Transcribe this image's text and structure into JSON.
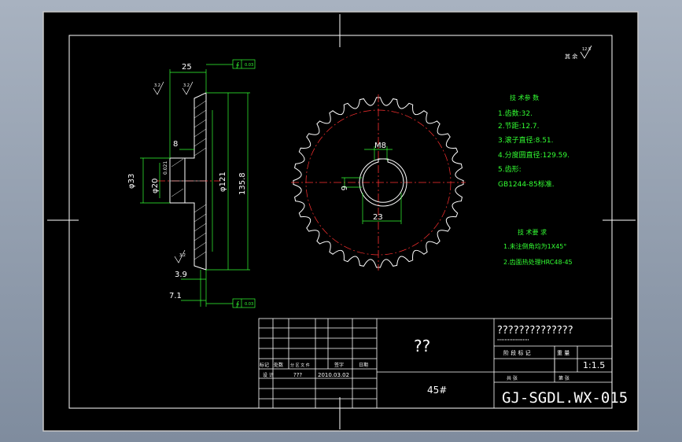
{
  "drawing": {
    "roughness_note": "其 余",
    "roughness_value": "12.5",
    "side_view": {
      "dim_width": "25",
      "dim_hub": "8",
      "dim_bore": "φ20",
      "dim_bore_tol": "0.021",
      "dim_hub_dia": "φ33",
      "dim_inner": "φ121",
      "dim_outer": "135.8",
      "dim_tooth": "3.9",
      "dim_offset": "7.1",
      "tol_top": "0.03",
      "tol_bottom": "0.03",
      "rough_1": "3.2",
      "rough_2": "3.2",
      "rough_3": "3.2"
    },
    "front_view": {
      "keyway_width": "M8",
      "keyway_depth": "6",
      "bore_span": "23"
    },
    "params": {
      "title": "技 术参 数",
      "lines": [
        "1.齿数:32.",
        "2.节距:12.7.",
        "3.滚子直径:8.51.",
        "4.分度圆直径:129.59.",
        "5.齿形:",
        "GB1244-85标准."
      ]
    },
    "requirements": {
      "title": "技 术要 求",
      "lines": [
        "1.未注倒角均为1X45°",
        "2.齿面热处理HRC48-45"
      ]
    }
  },
  "title_block": {
    "part_name": "??",
    "material": "45#",
    "company": "??????????????",
    "company_sub": "'''''''''''''''''''''",
    "scale": "1:1.5",
    "drawing_no": "GJ-SGDL.WX-015",
    "designer": "???",
    "date": "2010.03.02",
    "row_labels": [
      "标记",
      "处数",
      "分 区 文 件",
      "签字",
      "日期"
    ],
    "design_label": "设 计",
    "phase_label": "阶 段 标 记",
    "weight_label": "重 量",
    "sheets_label": "共 张",
    "sheet_label": "第 张"
  }
}
